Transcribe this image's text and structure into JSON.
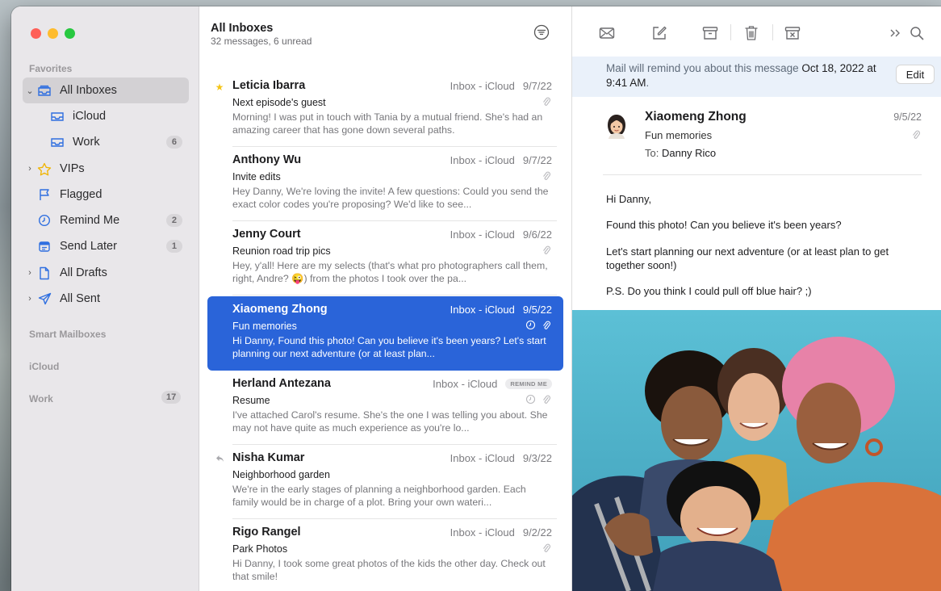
{
  "sidebar": {
    "favorites_title": "Favorites",
    "items": [
      {
        "label": "All Inboxes",
        "badge": ""
      },
      {
        "label": "iCloud",
        "badge": ""
      },
      {
        "label": "Work",
        "badge": "6"
      },
      {
        "label": "VIPs",
        "badge": ""
      },
      {
        "label": "Flagged",
        "badge": ""
      },
      {
        "label": "Remind Me",
        "badge": "2"
      },
      {
        "label": "Send Later",
        "badge": "1"
      },
      {
        "label": "All Drafts",
        "badge": ""
      },
      {
        "label": "All Sent",
        "badge": ""
      }
    ],
    "smart_title": "Smart Mailboxes",
    "icloud_title": "iCloud",
    "work_title": "Work",
    "work_badge": "17"
  },
  "list": {
    "title": "All Inboxes",
    "subtitle": "32 messages, 6 unread",
    "messages": [
      {
        "from": "Leticia Ibarra",
        "mailbox": "Inbox - iCloud",
        "date": "9/7/22",
        "subject": "Next episode's guest",
        "preview": "Morning! I was put in touch with Tania by a mutual friend. She's had an amazing career that has gone down several paths."
      },
      {
        "from": "Anthony Wu",
        "mailbox": "Inbox - iCloud",
        "date": "9/7/22",
        "subject": "Invite edits",
        "preview": "Hey Danny, We're loving the invite! A few questions: Could you send the exact color codes you're proposing? We'd like to see..."
      },
      {
        "from": "Jenny Court",
        "mailbox": "Inbox - iCloud",
        "date": "9/6/22",
        "subject": "Reunion road trip pics",
        "preview": "Hey, y'all! Here are my selects (that's what pro photographers call them, right, Andre? 😜) from the photos I took over the pa..."
      },
      {
        "from": "Xiaomeng Zhong",
        "mailbox": "Inbox - iCloud",
        "date": "9/5/22",
        "subject": "Fun memories",
        "preview": "Hi Danny, Found this photo! Can you believe it's been years? Let's start planning our next adventure (or at least plan..."
      },
      {
        "from": "Herland Antezana",
        "mailbox": "Inbox - iCloud",
        "date": "",
        "tag": "REMIND ME",
        "subject": "Resume",
        "preview": "I've attached Carol's resume. She's the one I was telling you about. She may not have quite as much experience as you're lo..."
      },
      {
        "from": "Nisha Kumar",
        "mailbox": "Inbox - iCloud",
        "date": "9/3/22",
        "subject": "Neighborhood garden",
        "preview": "We're in the early stages of planning a neighborhood garden. Each family would be in charge of a plot. Bring your own wateri..."
      },
      {
        "from": "Rigo Rangel",
        "mailbox": "Inbox - iCloud",
        "date": "9/2/22",
        "subject": "Park Photos",
        "preview": "Hi Danny, I took some great photos of the kids the other day. Check out that smile!"
      }
    ]
  },
  "reader": {
    "banner_prefix": "Mail will remind you about this message ",
    "banner_date": "Oct 18, 2022 at 9:41 AM",
    "banner_suffix": ".",
    "edit_label": "Edit",
    "from": "Xiaomeng Zhong",
    "subject": "Fun memories",
    "to_label": "To:",
    "to": "Danny Rico",
    "date": "9/5/22",
    "body": [
      "Hi Danny,",
      "Found this photo! Can you believe it's been years?",
      "Let's start planning our next adventure (or at least plan to get together soon!)",
      "P.S. Do you think I could pull off blue hair? ;)"
    ]
  },
  "colors": {
    "accent": "#2a64d9",
    "sidebar_icon": "#2f6fe0",
    "vip_star": "#f5c518",
    "traffic_red": "#fe5f57",
    "traffic_yellow": "#febc2e",
    "traffic_green": "#28c840"
  }
}
